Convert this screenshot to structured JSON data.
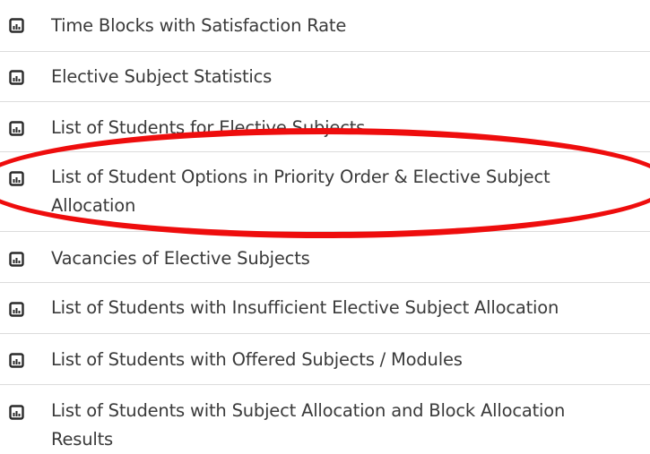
{
  "report_list": {
    "items": [
      {
        "label": "Time Blocks with Satisfaction Rate",
        "icon": "report-file-icon"
      },
      {
        "label": "Elective Subject Statistics",
        "icon": "report-file-icon"
      },
      {
        "label": "List of Students for Elective Subjects",
        "icon": "report-file-icon"
      },
      {
        "label": "List of Student Options in Priority Order & Elective Subject Allocation",
        "icon": "report-file-icon"
      },
      {
        "label": "Vacancies of Elective Subjects",
        "icon": "report-file-icon"
      },
      {
        "label": "List of Students with Insufficient Elective Subject Allocation",
        "icon": "report-file-icon"
      },
      {
        "label": "List of Students with Offered Subjects / Modules",
        "icon": "report-file-icon"
      },
      {
        "label": "List of Students with Subject Allocation and Block Allocation Results",
        "icon": "report-file-icon"
      }
    ],
    "highlighted_index": 3
  },
  "colors": {
    "highlight_ring": "#ee0d0d",
    "text": "#3a3a3a",
    "divider": "#dcdcdc",
    "icon": "#2b2b2b"
  }
}
